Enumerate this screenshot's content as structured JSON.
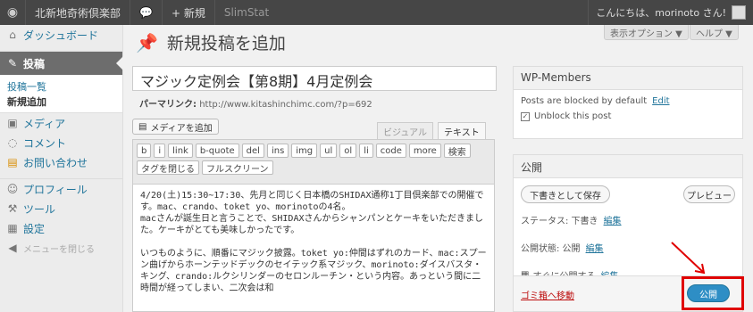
{
  "adminbar": {
    "site_name": "北新地奇術倶楽部",
    "new_label": "+ 新規",
    "plugin": "SlimStat",
    "greeting": "こんにちは、morinoto さん!"
  },
  "sidebar": {
    "dashboard": "ダッシュボード",
    "posts": "投稿",
    "sub_all": "投稿一覧",
    "sub_new": "新規追加",
    "media": "メディア",
    "comments": "コメント",
    "contact": "お問い合わせ",
    "profile": "プロフィール",
    "tools": "ツール",
    "settings": "設定",
    "collapse": "メニューを閉じる"
  },
  "header": {
    "page_title": "新規投稿を追加",
    "screen_options": "表示オプション ▼",
    "help": "ヘルプ ▼"
  },
  "post": {
    "title": "マジック定例会【第8期】4月定例会",
    "permalink_label": "パーマリンク:",
    "permalink_url": "http://www.kitashinchimc.com/?p=692"
  },
  "editor": {
    "add_media": "メディアを追加",
    "tab_visual": "ビジュアル",
    "tab_text": "テキスト",
    "buttons_row1": [
      "b",
      "i",
      "link",
      "b-quote",
      "del",
      "ins",
      "img",
      "ul",
      "ol",
      "li",
      "code",
      "more",
      "検索"
    ],
    "buttons_row2": [
      "タグを閉じる",
      "フルスクリーン"
    ],
    "paragraphs": [
      "4/20(土)15:30~17:30、先月と同じく日本橋のSHIDAX通称1丁目倶楽部での開催です。mac、crando、toket yo、morinotoの4名。\nmacさんが誕生日と言うことで、SHIDAXさんからシャンパンとケーキをいただきました。ケーキがとても美味しかったです。",
      "いつものように、順番にマジック披露。toket yo:仲間はずれのカード、mac:スプーン曲げからホーンテッドデックのセイテック系マジック、morinoto:ダイスバスタ・キング、crando:ルクシリンダーのセロンルーチン・という内容。あっという間に二時間が経ってしまい、二次会は和"
    ]
  },
  "wpmembers": {
    "title": "WP-Members",
    "blocked": "Posts are blocked by default",
    "edit": "Edit",
    "unblock": "Unblock this post"
  },
  "publish": {
    "title": "公開",
    "save_draft": "下書きとして保存",
    "preview": "プレビュー",
    "status_label": "ステータス: 下書き",
    "status_edit": "編集",
    "visibility_label": "公開状態: 公開",
    "visibility_edit": "編集",
    "schedule_label": "すぐに公開する",
    "schedule_edit": "編集",
    "trash": "ゴミ箱へ移動",
    "publish": "公開"
  }
}
